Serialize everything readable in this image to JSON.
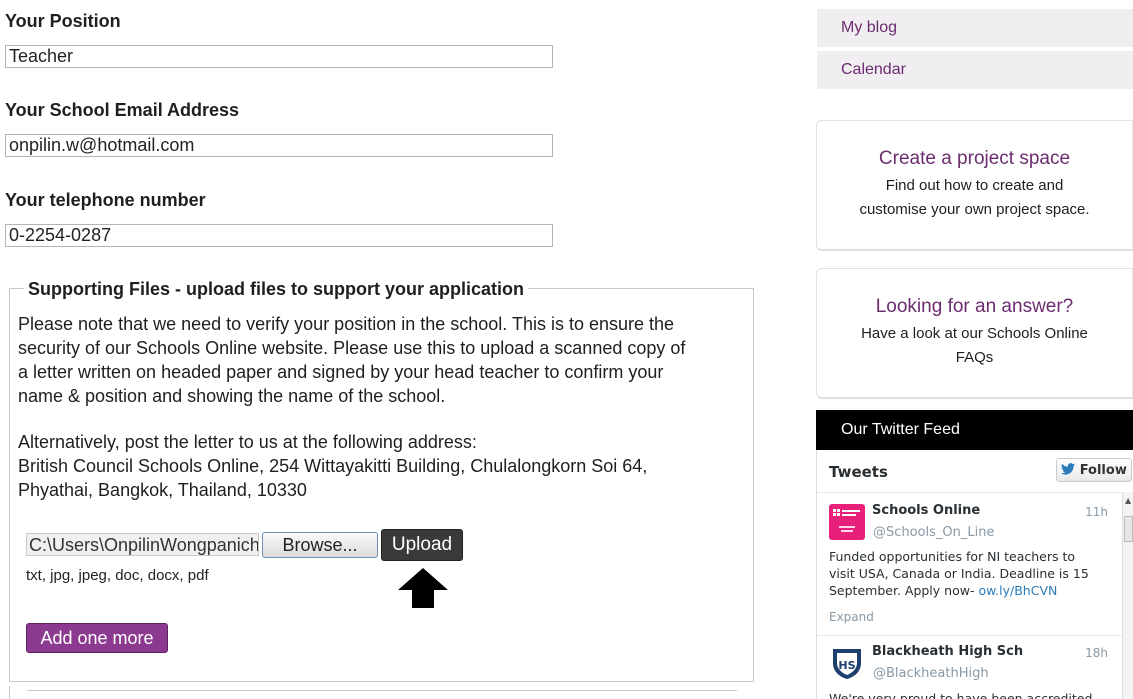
{
  "form": {
    "position": {
      "label": "Your Position",
      "value": "Teacher"
    },
    "email": {
      "label": "Your School Email Address",
      "value": "onpilin.w@hotmail.com"
    },
    "phone": {
      "label": "Your telephone number",
      "value": "0-2254-0287"
    }
  },
  "supporting_files": {
    "legend": "Supporting Files - upload files to support your application",
    "note_lines": [
      "Please note that we need to verify your position in the school. This is to ensure the",
      "security of our Schools Online website. Please use this to upload a scanned copy of",
      "a letter written on headed paper and signed by your head teacher to confirm your",
      "name & position and showing the name of the school."
    ],
    "alt_lines": [
      "Alternatively, post the letter to us at the following address:",
      "British Council Schools Online, 254 Wittayakitti Building, Chulalongkorn Soi 64,",
      "Phyathai, Bangkok, Thailand, 10330"
    ],
    "file_path": "C:\\Users\\OnpilinWongpanich",
    "browse_label": "Browse...",
    "upload_label": "Upload",
    "allowed_types": "txt, jpg, jpeg, doc, docx, pdf",
    "add_more_label": "Add one more",
    "pointer": "arrow-up-icon"
  },
  "sidebar": {
    "nav": [
      {
        "label": "My blog"
      },
      {
        "label": "Calendar"
      }
    ],
    "promos": [
      {
        "title": "Create a project space",
        "lines": [
          "Find out how to create and",
          "customise your own project space."
        ]
      },
      {
        "title": "Looking for an answer?",
        "lines": [
          "Have a look at our Schools Online",
          "FAQs"
        ]
      }
    ],
    "twitter": {
      "header": "Our Twitter Feed",
      "title": "Tweets",
      "follow_label": "Follow",
      "tweets": [
        {
          "name": "Schools Online",
          "handle": "@Schools_On_Line",
          "time": "11h",
          "lines": [
            "Funded opportunities for NI teachers to",
            "visit USA, Canada or India. Deadline is 15",
            "September. Apply now- "
          ],
          "link": "ow.ly/BhCVN",
          "expand": "Expand",
          "avatar_color": "#e8207a"
        },
        {
          "name": "Blackheath High Sch",
          "handle": "@BlackheathHigh",
          "time": "18h",
          "lines": [
            "We're very proud to have been accredited"
          ],
          "avatar_color": "#1c3f6e"
        }
      ]
    }
  },
  "colors": {
    "accent_purple": "#8b3a8f",
    "link_purple": "#6b2d6f",
    "twitter_blue": "#2b7bb9"
  }
}
